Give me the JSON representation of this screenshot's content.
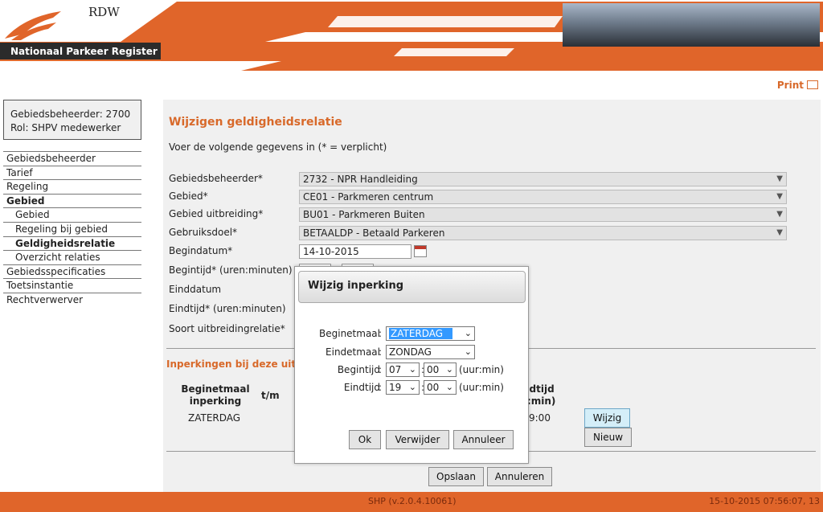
{
  "header": {
    "brand": "RDW",
    "app_title": "Nationaal Parkeer Register",
    "print_label": "Print",
    "colors": {
      "accent": "#e0652a",
      "dark": "#2b2b2b",
      "title": "#d8692a"
    }
  },
  "user": {
    "line1": "Gebiedsbeheerder: 2700",
    "line2": "Rol: SHPV medewerker"
  },
  "nav": {
    "items": [
      {
        "label": "Gebiedsbeheerder"
      },
      {
        "label": "Tarief"
      },
      {
        "label": "Regeling"
      },
      {
        "label": "Gebied"
      },
      {
        "label": "Gebied"
      },
      {
        "label": "Regeling bij gebied"
      },
      {
        "label": "Geldigheidsrelatie"
      },
      {
        "label": "Overzicht relaties"
      },
      {
        "label": "Gebiedsspecificaties"
      },
      {
        "label": "Toetsinstantie"
      },
      {
        "label": "Rechtverwerver"
      }
    ]
  },
  "form": {
    "title": "Wijzigen geldigheidsrelatie",
    "intro": "Voer de volgende gegevens in (* = verplicht)",
    "labels": {
      "beheerder": "Gebiedsbeheerder*",
      "gebied": "Gebied*",
      "uitbreiding": "Gebied uitbreiding*",
      "doel": "Gebruiksdoel*",
      "begindatum": "Begindatum*",
      "begintijd": "Begintijd* (uren:minuten)",
      "einddatum": "Einddatum",
      "eindtijd": "Eindtijd* (uren:minuten)",
      "soort": "Soort uitbreidingrelatie*"
    },
    "values": {
      "beheerder": "2732 - NPR Handleiding",
      "gebied": "CE01 - Parkmeren centrum",
      "uitbreiding": "BU01 - Parkmeren Buiten",
      "doel": "BETAALDP - Betaald Parkeren",
      "begindatum": "14-10-2015"
    }
  },
  "inperkingen": {
    "title": "Inperkingen bij deze uitb",
    "headers": {
      "begin": "Beginetmaal inperking",
      "tm": "t/m",
      "eind": "ndtijd r:min)"
    },
    "row": {
      "begin": "ZATERDAG",
      "eindtijd": "9:00"
    },
    "wijzig_label": "Wijzig",
    "nieuw_label": "Nieuw"
  },
  "actions": {
    "save": "Opslaan",
    "cancel": "Annuleren"
  },
  "modal": {
    "title": "Wijzig inperking",
    "labels": {
      "begin": "Beginetmaal",
      "eind": "Eindetmaal",
      "begintijd": "Begintijd",
      "eindtijd": "Eindtijd"
    },
    "colon": ":",
    "beginetmaal": "ZATERDAG",
    "eindetmaal": "ZONDAG",
    "begin_hour": "07",
    "begin_min": "00",
    "end_hour": "19",
    "end_min": "00",
    "unit": "(uur:min)",
    "buttons": {
      "ok": "Ok",
      "delete": "Verwijder",
      "cancel": "Annuleer"
    }
  },
  "footer": {
    "version": "SHP (v.2.0.4.10061)",
    "timestamp": "15-10-2015 07:56:07, 13"
  }
}
